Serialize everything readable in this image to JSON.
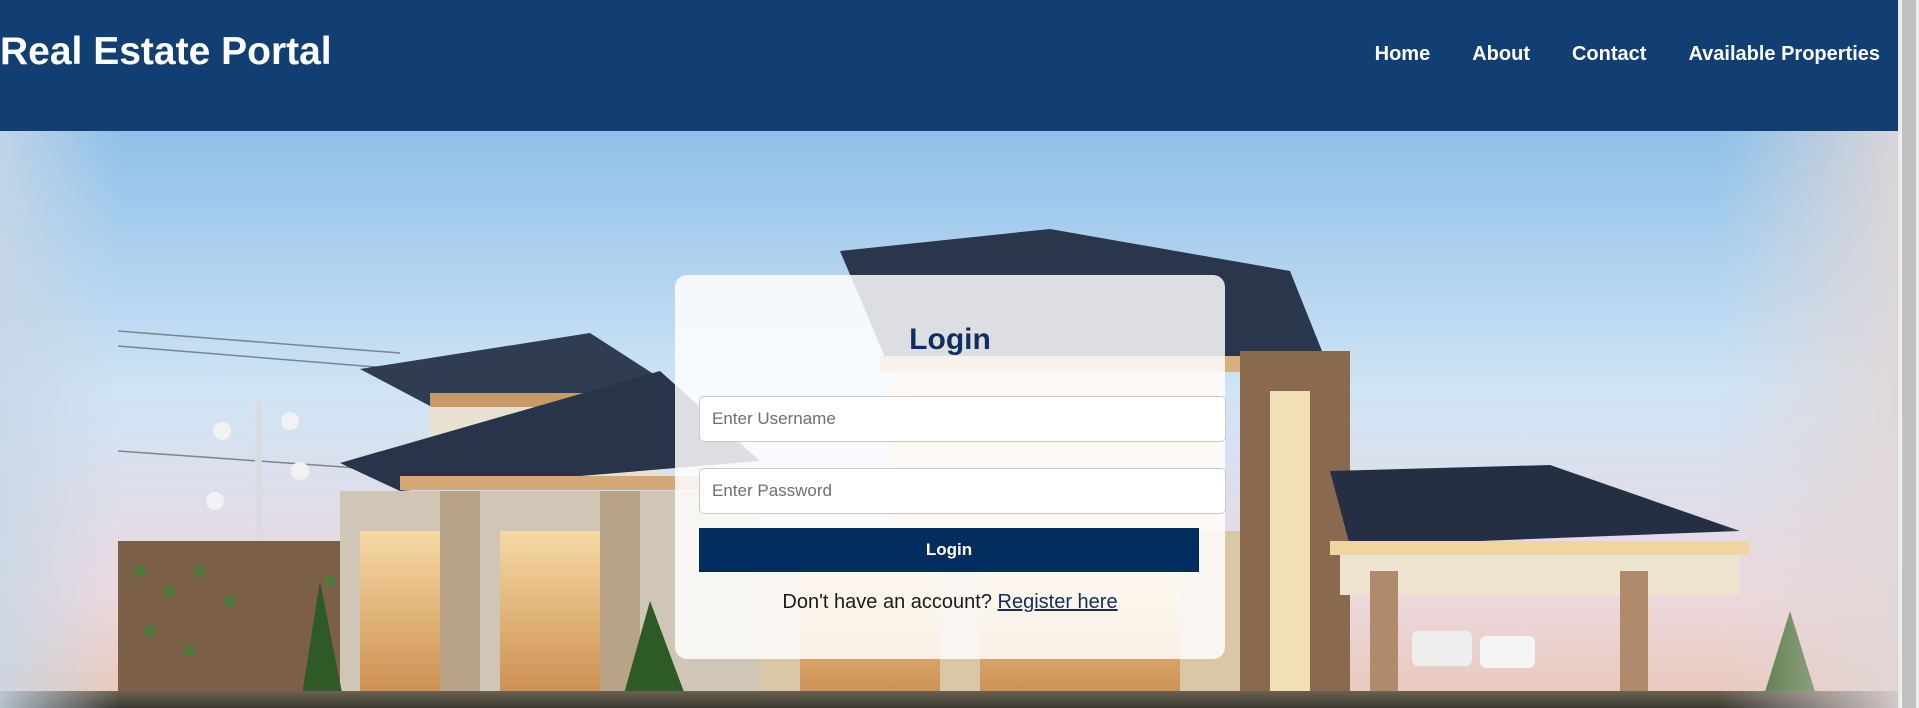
{
  "header": {
    "site_title": "Real Estate Portal",
    "nav": [
      {
        "label": "Home"
      },
      {
        "label": "About"
      },
      {
        "label": "Contact"
      },
      {
        "label": "Available Properties"
      }
    ]
  },
  "login": {
    "title": "Login",
    "username_placeholder": "Enter Username",
    "password_placeholder": "Enter Password",
    "button_label": "Login",
    "register_prompt": "Don't have an account?",
    "register_link": "Register here"
  },
  "colors": {
    "header_bg": "#113f74",
    "button_bg": "#042d5f",
    "title_color": "#0e2f5f"
  },
  "hero": {
    "image": "house-photo"
  }
}
